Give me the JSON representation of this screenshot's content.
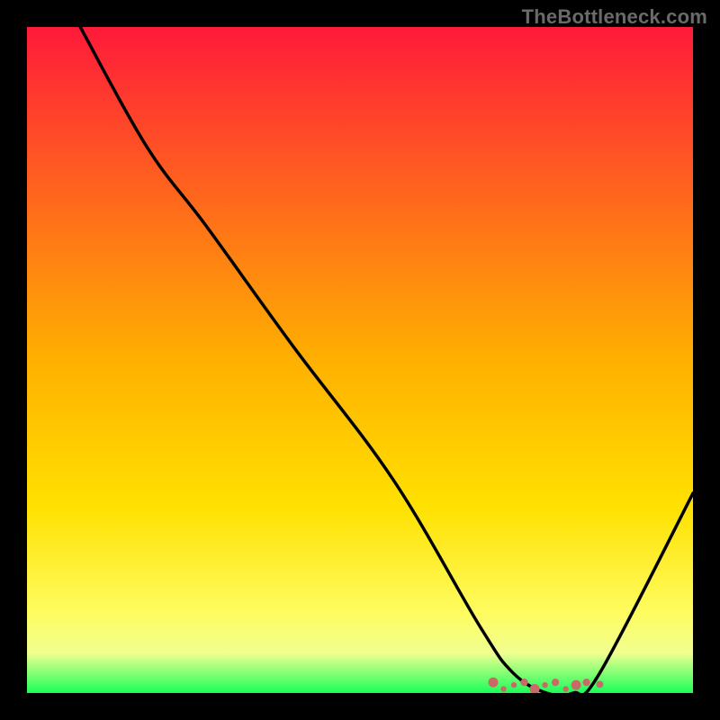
{
  "source_label": "TheBottleneck.com",
  "colors": {
    "gradient_top": "#ff1a3a",
    "gradient_mid": "#ffd500",
    "gradient_bottom1": "#ffff7a",
    "gradient_bottom2": "#f8ffa0",
    "gradient_bottom3": "#1aff5a",
    "curve": "#000000",
    "valley_dots": "#c96a66",
    "background": "#000000"
  },
  "chart_data": {
    "type": "line",
    "title": "",
    "xlabel": "",
    "ylabel": "",
    "xlim": [
      0,
      100
    ],
    "ylim": [
      0,
      100
    ],
    "series": [
      {
        "name": "bottleneck-curve",
        "x": [
          8,
          18,
          27,
          40,
          55,
          68,
          73,
          78,
          82,
          86,
          100
        ],
        "y": [
          100,
          82,
          70,
          52,
          32,
          10,
          3,
          0,
          0,
          3,
          30
        ]
      }
    ],
    "annotations": [
      {
        "type": "valley-dots",
        "x_range": [
          70,
          84
        ],
        "y": 1,
        "count": 10
      }
    ],
    "gradient_bands": [
      {
        "pos": 0.0,
        "color": "#ff1a3a"
      },
      {
        "pos": 0.5,
        "color": "#ffb000"
      },
      {
        "pos": 0.72,
        "color": "#ffe100"
      },
      {
        "pos": 0.88,
        "color": "#fffc60"
      },
      {
        "pos": 0.94,
        "color": "#f0ff90"
      },
      {
        "pos": 1.0,
        "color": "#1aff5a"
      }
    ]
  }
}
